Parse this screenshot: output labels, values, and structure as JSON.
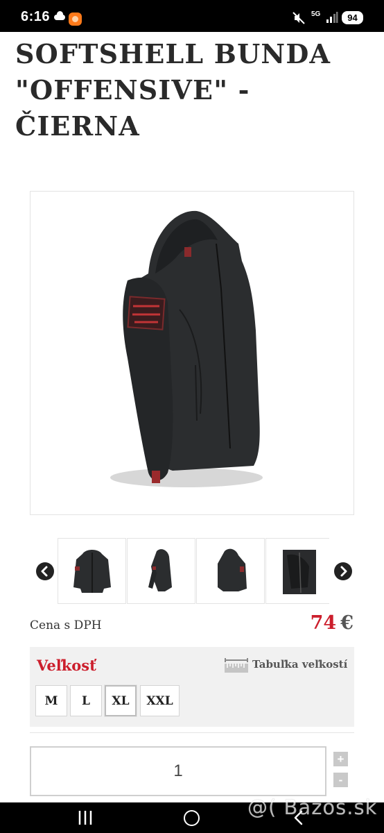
{
  "status_bar": {
    "time": "6:16",
    "network": "5G",
    "battery": "94",
    "icons": [
      "cloud-icon",
      "app-notification-icon",
      "mute-icon",
      "signal-icon",
      "battery-icon"
    ]
  },
  "product": {
    "title": "SOFTSHELL BUNDA \"OFFENSIVE\" - ČIERNA",
    "main_image": "black softshell jacket with red patch on sleeve",
    "thumbnails": [
      "jacket front view",
      "jacket side view",
      "jacket back view",
      "jacket detail view"
    ]
  },
  "price": {
    "label": "Cena s DPH",
    "amount": "74",
    "currency": "€"
  },
  "size": {
    "label": "Veľkosť",
    "table_link": "Tabuľka veľkostí",
    "options": [
      "M",
      "L",
      "XL",
      "XXL"
    ],
    "selected": "XL"
  },
  "quantity": {
    "value": "1",
    "plus": "+",
    "minus": "-"
  },
  "watermark": "@( Bazos.sk",
  "colors": {
    "accent_red": "#cc1e2c",
    "panel_bg": "#f1f1f1"
  }
}
